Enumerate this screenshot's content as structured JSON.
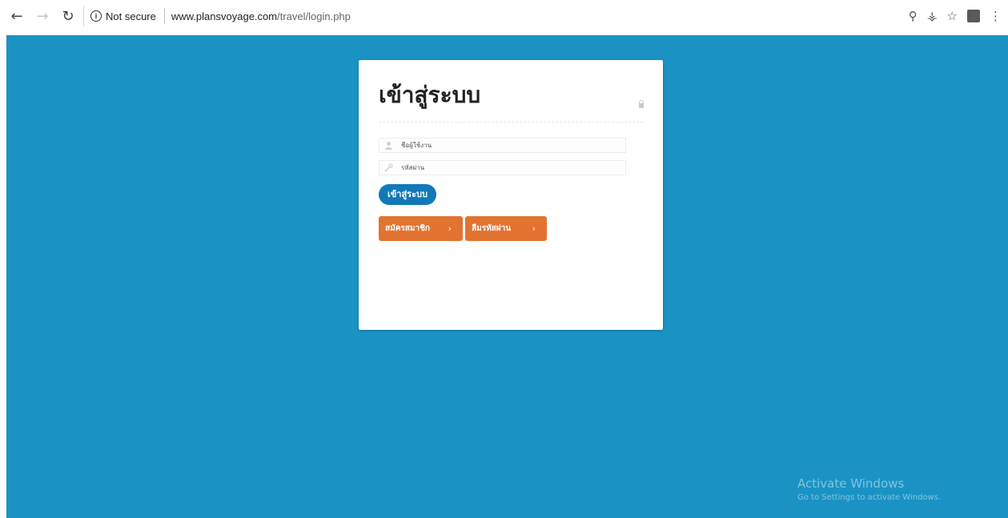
{
  "browser": {
    "back_icon": "arrow-left-icon",
    "forward_icon": "arrow-right-icon",
    "reload_icon": "reload-icon",
    "security_text": "Not secure",
    "url_host": "www.plansvoyage.com",
    "url_path": "/travel/login.php",
    "right_icons": [
      "zoom-icon",
      "key-icon",
      "star-icon",
      "extension-icon",
      "menu-icon"
    ]
  },
  "page": {
    "background_color": "#1a93c4"
  },
  "login": {
    "title": "เข้าสู่ระบบ",
    "username_placeholder": "ชื่อผู้ใช้งาน",
    "password_placeholder": "รหัสผ่าน",
    "submit_label": "เข้าสู่ระบบ",
    "register_label": "สมัครสมาชิก",
    "forgot_label": "ลืมรหัสผ่าน",
    "arrow": "›",
    "button_blue": "#1279b8",
    "button_orange": "#e27331"
  },
  "watermark": {
    "line1": "Activate Windows",
    "line2": "Go to Settings to activate Windows."
  }
}
